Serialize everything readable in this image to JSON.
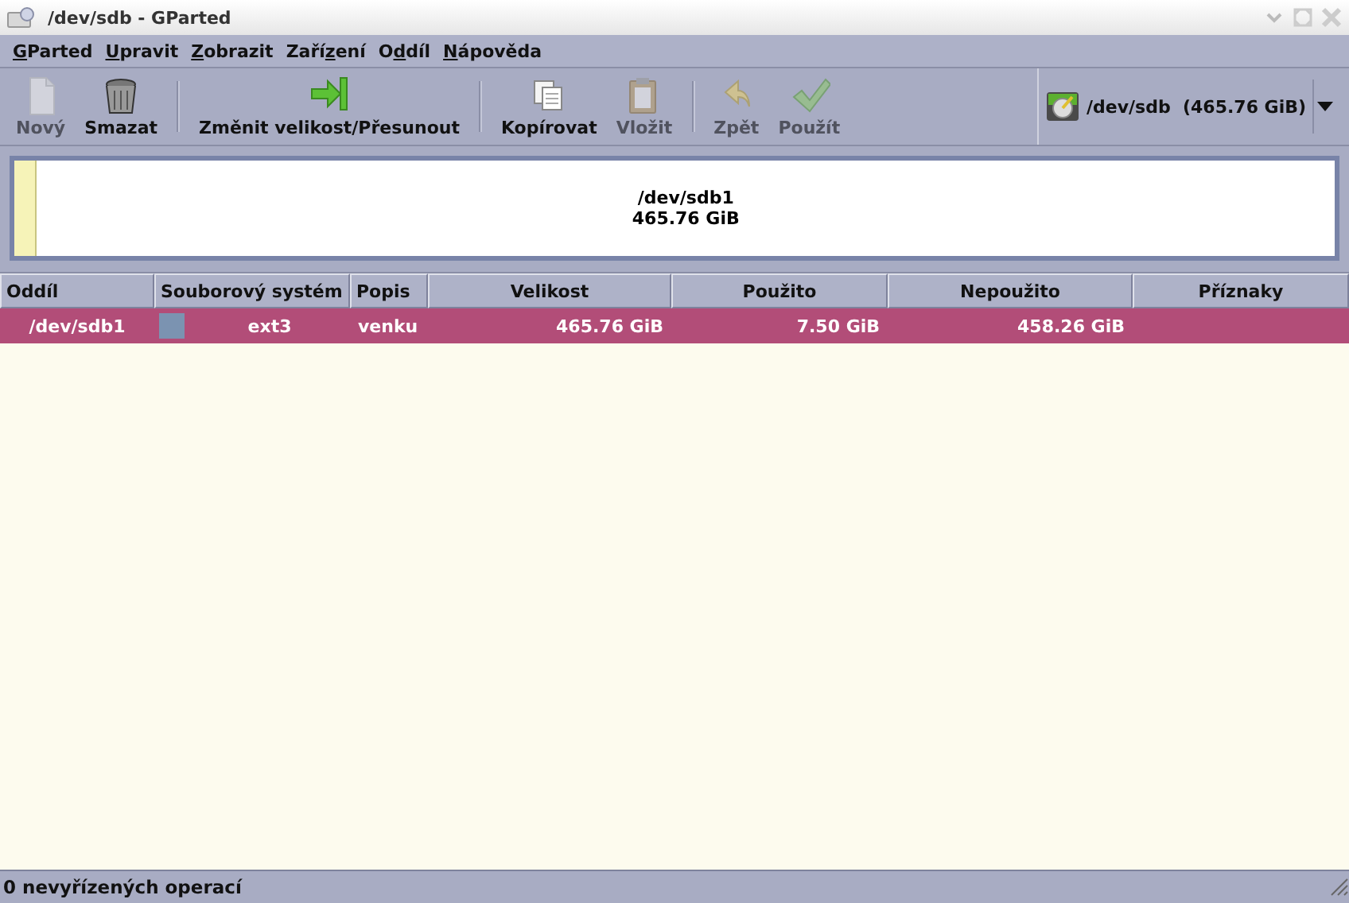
{
  "window": {
    "title": "/dev/sdb - GParted"
  },
  "menu": [
    {
      "key": "G",
      "post": "Parted"
    },
    {
      "key": "U",
      "post": "pravit"
    },
    {
      "key": "Z",
      "post": "obrazit"
    },
    {
      "pre": "Zaří",
      "key": "z",
      "post": "ení"
    },
    {
      "pre": "O",
      "key": "d",
      "post": "díl"
    },
    {
      "key": "N",
      "post": "ápověda"
    }
  ],
  "toolbar": [
    {
      "kind": "new",
      "label": "Nový",
      "disabled": true
    },
    {
      "kind": "delete",
      "label": "Smazat",
      "disabled": false
    },
    {
      "kind": "separator"
    },
    {
      "kind": "resize",
      "label": "Změnit velikost/Přesunout",
      "disabled": false
    },
    {
      "kind": "separator"
    },
    {
      "kind": "copy",
      "label": "Kopírovat",
      "disabled": false
    },
    {
      "kind": "paste",
      "label": "Vložit",
      "disabled": true
    },
    {
      "kind": "separator"
    },
    {
      "kind": "undo",
      "label": "Zpět",
      "disabled": true
    },
    {
      "kind": "apply",
      "label": "Použít",
      "disabled": true
    }
  ],
  "device": {
    "name": "/dev/sdb",
    "size": "(465.76 GiB)"
  },
  "disk_map": {
    "partitions": [
      {
        "name": "/dev/sdb1",
        "size": "465.76 GiB",
        "level": 0.016
      }
    ]
  },
  "table": {
    "columns": [
      "Oddíl",
      "Souborový systém",
      "Popis",
      "Velikost",
      "Použito",
      "Nepoužito",
      "Příznaky"
    ],
    "rows": [
      {
        "partition": "/dev/sdb1",
        "color": "#7b93b1",
        "filesystem": "ext3",
        "label": "venku",
        "size": "465.76 GiB",
        "used": "7.50 GiB",
        "unused": "458.26 GiB",
        "selected": true
      }
    ]
  },
  "status_bar": "0 nevyřízených operací"
}
